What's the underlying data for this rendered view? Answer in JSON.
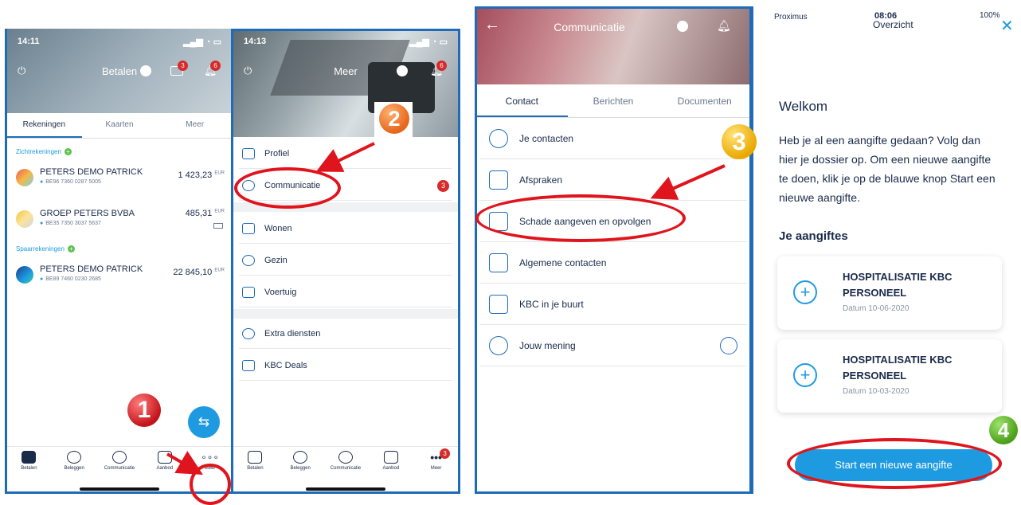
{
  "screen1": {
    "time": "14:11",
    "title": "Betalen",
    "msg_badge": "3",
    "bell_badge": "6",
    "tabs": [
      "Rekeningen",
      "Kaarten",
      "Meer"
    ],
    "section_checking": "Zichtrekeningen",
    "section_savings": "Spaarrekeningen",
    "accounts": [
      {
        "name": "PETERS DEMO PATRICK",
        "iban": "BE96 7360 0287 5005",
        "amount": "1 423,23",
        "currency": "EUR",
        "color": "#f4b844"
      },
      {
        "name": "GROEP PETERS BVBA",
        "iban": "BE35 7350 3037 5637",
        "amount": "485,31",
        "currency": "EUR",
        "color": "#f4c542"
      },
      {
        "name": "PETERS DEMO PATRICK",
        "iban": "BE89 7460 0230 2685",
        "amount": "22 845,10",
        "currency": "EUR",
        "color": "#1e5fb0"
      }
    ],
    "nav": [
      "Betalen",
      "Beleggen",
      "Communicatie",
      "Aanbod",
      "Meer"
    ],
    "step": "1"
  },
  "screen2": {
    "time": "14:13",
    "title": "Meer",
    "bell_badge": "6",
    "menu": [
      "Profiel",
      "Communicatie",
      "Wonen",
      "Gezin",
      "Voertuig",
      "Extra diensten",
      "KBC Deals"
    ],
    "comm_badge": "3",
    "nav": [
      "Betalen",
      "Beleggen",
      "Communicatie",
      "Aanbod",
      "Meer"
    ],
    "nav_badge": "3",
    "step": "2"
  },
  "screen3": {
    "title": "Communicatie",
    "tabs": [
      "Contact",
      "Berichten",
      "Documenten"
    ],
    "rows": [
      "Je contacten",
      "Afspraken",
      "Schade aangeven en opvolgen",
      "Algemene contacten",
      "KBC in je buurt",
      "Jouw mening"
    ],
    "step": "3"
  },
  "screen4": {
    "carrier": "Proximus",
    "time": "08:06",
    "title": "Overzicht",
    "battery": "100%",
    "welcome": "Welkom",
    "intro": "Heb je al een aangifte gedaan? Volg dan hier je dossier op. Om een nieuwe aangifte te doen, klik je op de blauwe knop Start een nieuwe aangifte.",
    "section": "Je aangiftes",
    "claims": [
      {
        "title": "HOSPITALISATIE KBC PERSONEEL",
        "date": "Datum 10-06-2020"
      },
      {
        "title": "HOSPITALISATIE KBC PERSONEEL",
        "date": "Datum 10-03-2020"
      }
    ],
    "button": "Start een nieuwe aangifte",
    "step": "4"
  },
  "colors": {
    "accent": "#1e9be0",
    "frame": "#1e6bb8",
    "highlight": "#e0141c"
  }
}
